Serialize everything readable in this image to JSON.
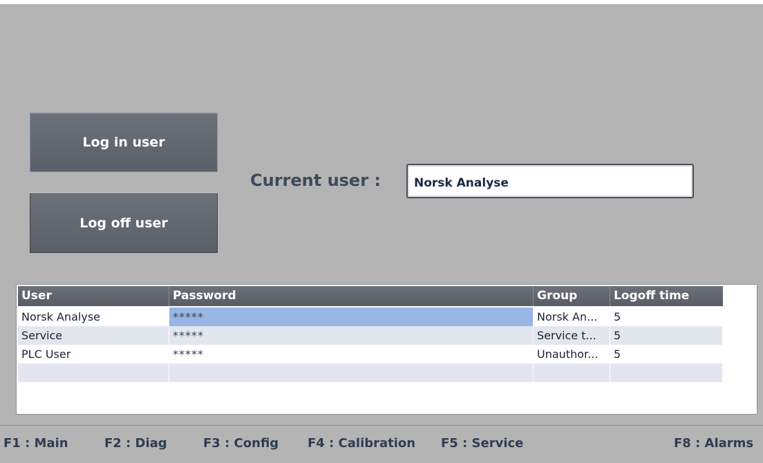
{
  "buttons": {
    "login": "Log in user",
    "logoff": "Log off user"
  },
  "current_user": {
    "label": "Current user :",
    "value": "Norsk Analyse"
  },
  "table": {
    "columns": [
      "User",
      "Password",
      "Group",
      "Logoff time"
    ],
    "rows": [
      {
        "user": "Norsk Analyse",
        "password": "*****",
        "group": "Norsk An...",
        "logoff": "5"
      },
      {
        "user": "Service",
        "password": "*****",
        "group": "Service t...",
        "logoff": "5"
      },
      {
        "user": "PLC User",
        "password": "*****",
        "group": "Unauthor...",
        "logoff": "5"
      },
      {
        "user": "",
        "password": "",
        "group": "",
        "logoff": ""
      }
    ]
  },
  "function_keys": {
    "f1": "F1 : Main",
    "f2": "F2 : Diag",
    "f3": "F3 : Config",
    "f4": "F4 : Calibration",
    "f5": "F5 : Service",
    "f8": "F8 : Alarms"
  },
  "colors": {
    "background": "#b4b4b4",
    "button": "#62666f",
    "header": "#62666f",
    "selection": "#97b6e3",
    "label_text": "#3d4a5c"
  }
}
